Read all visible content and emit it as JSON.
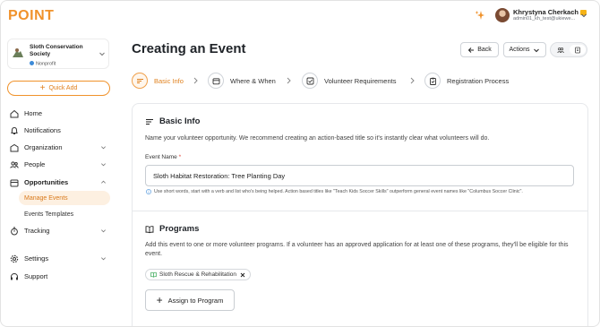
{
  "app": {
    "logo": "POINT"
  },
  "user": {
    "name": "Khrystyna Cherkach",
    "email": "admin01_kh_test@ukiewe..."
  },
  "organization": {
    "name": "Sloth Conservation Society",
    "type": "Nonprofit"
  },
  "sidebar": {
    "quick_add_label": "Quick Add",
    "items": [
      {
        "label": "Home",
        "icon": "home-icon"
      },
      {
        "label": "Notifications",
        "icon": "bell-icon"
      },
      {
        "label": "Organization",
        "icon": "building-icon"
      },
      {
        "label": "People",
        "icon": "people-icon"
      },
      {
        "label": "Opportunities",
        "icon": "calendar-icon"
      },
      {
        "label": "Tracking",
        "icon": "timer-icon"
      },
      {
        "label": "Settings",
        "icon": "gear-icon"
      },
      {
        "label": "Support",
        "icon": "headset-icon"
      }
    ],
    "opportunities_sub": [
      {
        "label": "Manage Events",
        "active": true
      },
      {
        "label": "Events Templates",
        "active": false
      }
    ]
  },
  "header": {
    "title": "Creating an Event",
    "back_label": "Back",
    "actions_label": "Actions"
  },
  "steps": [
    {
      "label": "Basic Info",
      "active": true
    },
    {
      "label": "Where & When",
      "active": false
    },
    {
      "label": "Volunteer Requirements",
      "active": false
    },
    {
      "label": "Registration Process",
      "active": false
    }
  ],
  "basic_info": {
    "title": "Basic Info",
    "description": "Name your volunteer opportunity. We recommend creating an action-based title so it's instantly clear what volunteers will do.",
    "event_name_label": "Event Name",
    "required_mark": "*",
    "event_name_value": "Sloth Habitat Restoration: Tree Planting Day",
    "hint": "Use short words, start with a verb and list who's being helped. Action based titles like \"Teach Kids Soccer Skills\" outperform general event names like \"Columbus Soccer Clinic\"."
  },
  "programs": {
    "title": "Programs",
    "description": "Add this event to one or more volunteer programs. If a volunteer has an approved application for at least one of these programs, they'll be eligible for this event.",
    "selected": [
      {
        "label": "Sloth Rescue & Rehabilitation"
      }
    ],
    "assign_label": "Assign to Program"
  },
  "colors": {
    "brand": "#f0922b",
    "active_bg": "#fdf0e1",
    "info": "#3d8bd8"
  }
}
